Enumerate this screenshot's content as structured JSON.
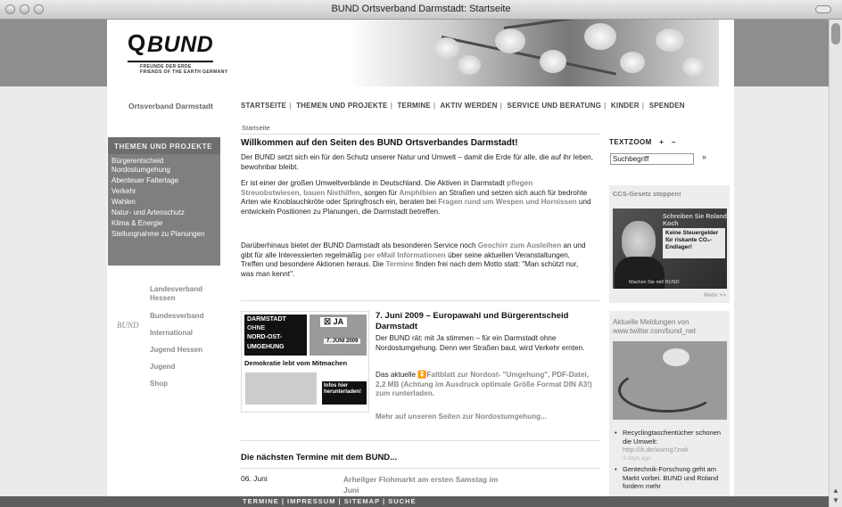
{
  "window": {
    "title": "BUND Ortsverband Darmstadt: Startseite"
  },
  "logo": {
    "name": "BUND",
    "line1": "FREUNDE DER ERDE",
    "line2": "FRIENDS OF THE EARTH GERMANY"
  },
  "site": {
    "ortsverband": "Ortsverband Darmstadt"
  },
  "nav": [
    "STARTSEITE",
    "THEMEN UND PROJEKTE",
    "TERMINE",
    "AKTIV WERDEN",
    "SERVICE UND BERATUNG",
    "KINDER",
    "SPENDEN"
  ],
  "breadcrumb": "Startseite",
  "sidebar": {
    "heading": "THEMEN UND PROJEKTE",
    "items": [
      "Bürgerentscheid Nordostumgehung",
      "Abenteuer Faltertage",
      "Verkehr",
      "Wahlen",
      "Natur- und Artenschutz",
      "Klima & Energie",
      "Stellungnahme zu Planungen"
    ]
  },
  "links": {
    "bund_mark": "BUND",
    "items": [
      "Landesverband Hessen",
      "Bundesverband",
      "International",
      "Jugend Hessen",
      "Jugend",
      "Shop"
    ]
  },
  "main": {
    "heading": "Willkommen auf den Seiten des BUND Ortsverbandes Darmstadt!",
    "p1": "Der BUND setzt sich ein für den Schutz unserer Natur und Umwelt – damit die Erde für alle, die auf ihr leben, bewohnbar bleibt.",
    "p2": {
      "t1": "Er ist einer der großen Umweltverbände in Deutschland. Die Aktiven in Darmstadt ",
      "l1": "pflegen Streuobstwiesen",
      "t2": ", ",
      "l2": "bauen Nisthilfen",
      "t3": ", sorgen für ",
      "l3": "Amphibien",
      "t4": " an Straßen und setzen sich auch für bedrohte Arten wie Knoblauchkröte oder Springfrosch ein, beraten bei ",
      "l4": "Fragen rund um Wespen und Hornissen",
      "t5": " und entwickeln Positionen zu Planungen, die Darmstadt betreffen."
    },
    "p3": {
      "t1": "Darüberhinaus bietet der BUND Darmstadt als besonderen Service noch ",
      "l1": "Geschirr zum Ausleihen",
      "t2": " an und gibt für alle Interessierten regelmäßig ",
      "l2": "per eMail Informationen",
      "t3": " über seine aktuellen Veranstaltungen, Treffen und besondere Aktionen heraus. Die ",
      "l3": "Termine",
      "t4": " finden frei nach dem Motto statt: \"Man schützt nur, was man kennt\"."
    }
  },
  "poster": {
    "l1": "DARMSTADT",
    "l2": "OHNE",
    "l3": "NORD-OST-",
    "l4": "UMGEHUNG",
    "ja": "JA",
    "date": "7. JUNI 2009",
    "slogan": "Demokratie lebt vom Mitmachen",
    "info": "Infos hier herunterladen!"
  },
  "article": {
    "heading": "7. Juni 2009 – Europawahl und Bürgerentscheid Darmstadt",
    "p1": "Der BUND rät: mit Ja stimmen – für ein Darmstadt ohne Nordostumgehung. Denn wer Straßen baut, wird Verkehr ernten.",
    "p2_pre": "Das aktuelle ",
    "p2_link": "Faltblatt zur Nordost- \"Umgehung\", PDF-Datei, 2,2 MB (Achtung im Ausdruck optimale Größe Format DIN A3!) zum runterladen.",
    "more": "Mehr auf unseren Seiten zur Nordostumgehung..."
  },
  "termine": {
    "heading": "Die nächsten Termine mit dem BUND...",
    "date": "06. Juni",
    "title": "Arheilger Flohmarkt am ersten Samstag im Juni"
  },
  "right": {
    "textzoom": "TEXTZOOM",
    "zoom_plus": "+",
    "zoom_minus": "–",
    "search_value": "Suchbegriff",
    "go": "»",
    "ccs_title": "CCS-Gesetz stoppen!",
    "ccs_t1": "Schreiben Sie Roland Koch",
    "ccs_t2": "Keine Steuergelder für riskante CO₂-Endlager!",
    "ccs_t3": "Machen Sie mit! BUND",
    "mehr": "Mehr >>",
    "tw_title": "Aktuelle Meldungen von www.twitter.com/bund_net",
    "tw_items": [
      {
        "text": "Recyclingtaschentücher schonen die Umwelt:",
        "link": "http://ilt.de/wamg7zwk",
        "age": "3 days ago"
      },
      {
        "text": "Gentechnik-Forschung geht am Markt vorbei. BUND und Roland fordern mehr",
        "link": "",
        "age": ""
      }
    ]
  },
  "footer": [
    "TERMINE",
    "IMPRESSUM",
    "SITEMAP",
    "SUCHE"
  ],
  "colors": {
    "accent": "#8a8a8a",
    "sidebar": "#7f7f7f",
    "footer": "#5e5e5e"
  }
}
